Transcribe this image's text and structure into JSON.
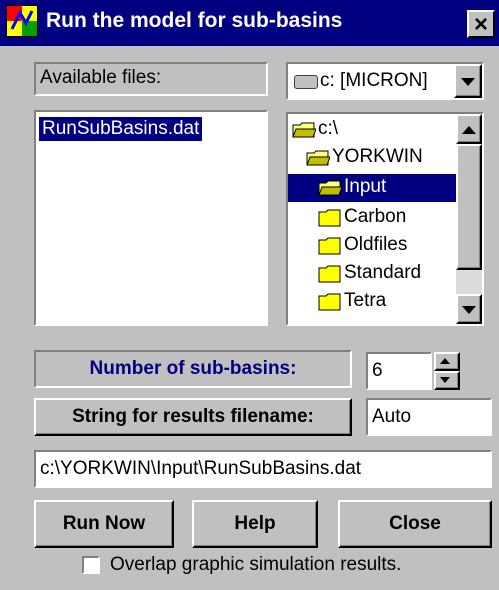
{
  "window": {
    "title": "Run the model for sub-basins",
    "close_label": "×"
  },
  "available_files_label": "Available files:",
  "drive": {
    "value": "c: [MICRON]",
    "icon": "drive-icon"
  },
  "files": [
    "RunSubBasins.dat"
  ],
  "directories": [
    {
      "label": "c:\\",
      "icon": "open-folder-icon"
    },
    {
      "label": "YORKWIN",
      "icon": "open-folder-icon"
    },
    {
      "label": "Input",
      "icon": "open-folder-icon",
      "selected": true
    },
    {
      "label": "Carbon",
      "icon": "folder-icon"
    },
    {
      "label": "Oldfiles",
      "icon": "folder-icon"
    },
    {
      "label": "Standard",
      "icon": "folder-icon"
    },
    {
      "label": "Tetra",
      "icon": "folder-icon"
    }
  ],
  "sub_basins": {
    "label": "Number of sub-basins:",
    "value": "6"
  },
  "results_string": {
    "label": "String for results filename:",
    "value": "Auto"
  },
  "path": "c:\\YORKWIN\\Input\\RunSubBasins.dat",
  "buttons": {
    "run": "Run Now",
    "help": "Help",
    "close": "Close"
  },
  "overlap": {
    "label": "Overlap graphic simulation results.",
    "checked": false
  },
  "colors": {
    "titlebar": "#000080",
    "face": "#c0c0c0",
    "selection": "#000080"
  }
}
